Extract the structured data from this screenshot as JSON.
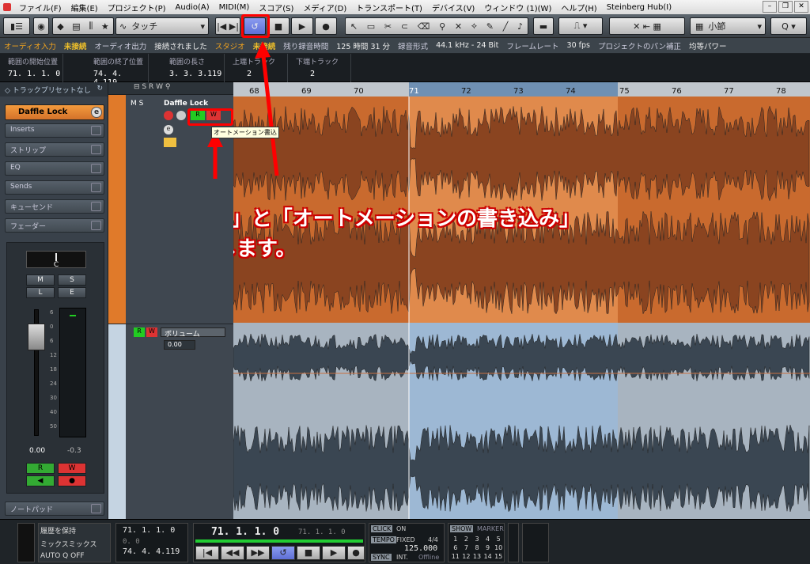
{
  "menu": [
    "ファイル(F)",
    "編集(E)",
    "プロジェクト(P)",
    "Audio(A)",
    "MIDI(M)",
    "スコア(S)",
    "メディア(D)",
    "トランスポート(T)",
    "デバイス(V)",
    "ウィンドウ (1)(W)",
    "ヘルプ(H)",
    "Steinberg Hub(I)"
  ],
  "toolbar": {
    "automation_mode": "タッチ",
    "snap": "小節"
  },
  "infobar": {
    "audio_in_label": "オーディオ入力",
    "audio_in": "未接続",
    "audio_out_label": "オーディオ出力",
    "audio_out": "接続されました",
    "studio_label": "スタジオ",
    "studio": "未接続",
    "rec_time_label": "残り録音時間",
    "rec_time": "125 時間 31 分",
    "rec_format_label": "録音形式",
    "rec_format": "44.1 kHz - 24 Bit",
    "framerate_label": "フレームレート",
    "framerate": "30 fps",
    "pan_label": "プロジェクトのパン補正",
    "pan": "均等パワー"
  },
  "eventbar": [
    {
      "h": "範囲の開始位置",
      "v": "71. 1. 1.  0"
    },
    {
      "h": "範囲の終了位置",
      "v": "74. 4. 4.119"
    },
    {
      "h": "範囲の長さ",
      "v": "3. 3. 3.119"
    },
    {
      "h": "上端トラック",
      "v": "2"
    },
    {
      "h": "下端トラック",
      "v": "2"
    }
  ],
  "inspector": {
    "preset": "トラックプリセットなし",
    "track_name": "Daffle Lock",
    "sections": [
      "Inserts",
      "ストリップ",
      "EQ",
      "Sends",
      "キューセンド",
      "フェーダー"
    ],
    "pan_value": "C",
    "vol_value": "0.00",
    "peak_value": "-0.3",
    "notepad": "ノートパッド",
    "scale": [
      "6",
      "0",
      "6",
      "12",
      "18",
      "24",
      "30",
      "40",
      "50"
    ]
  },
  "tracks": [
    {
      "name": "Daffle Lock",
      "tooltip": "オートメーション書込"
    },
    {
      "name": "ボリューム",
      "value": "0.00"
    }
  ],
  "ruler": [
    "68",
    "69",
    "70",
    "71",
    "72",
    "73",
    "74",
    "75",
    "76",
    "77",
    "78"
  ],
  "annotation": {
    "line1": "「サイクル」と「オートメーションの書き込み」",
    "line2": "をオンにします。"
  },
  "transport": {
    "history": "履歴を保持",
    "mix": "ミックスミックス",
    "auto_q": "AUTO Q",
    "auto_q_val": "OFF",
    "left_loc": "71. 1. 1.   0",
    "right_loc": "74. 4. 4.119",
    "zero1": "0. 0",
    "zero2": "0. 0",
    "position": "71. 1. 1.   0",
    "position2": "71. 1. 1.   0",
    "click": "CLICK",
    "click_on": "ON",
    "tempo": "TEMPO",
    "tempo_mode": "FIXED",
    "sig": "4/4",
    "tempo_val": "125.000",
    "sync": "SYNC",
    "sync_mode": "INT.",
    "sync_state": "Offline",
    "show": "SHOW",
    "marker": "MARKER",
    "markers": [
      "1",
      "2",
      "3",
      "4",
      "5",
      "6",
      "7",
      "8",
      "9",
      "10",
      "11",
      "12",
      "13",
      "14",
      "15"
    ]
  },
  "colors": {
    "accent": "#f08a2c",
    "cycle": "#6f90b3",
    "wave_orange": "#e8874a",
    "wave_blue": "#a9c0d8"
  }
}
